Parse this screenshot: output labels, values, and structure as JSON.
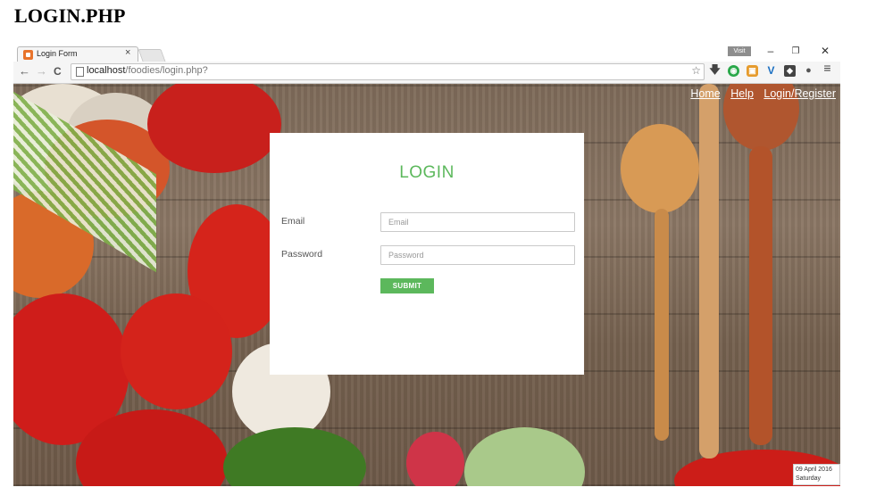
{
  "doc_title": "LOGIN.PHP",
  "browser": {
    "tab_title": "Login Form",
    "tab_close": "×",
    "user_badge": "Visit",
    "window_controls": {
      "minimize": "–",
      "restore": "❐",
      "close": "✕"
    },
    "nav": {
      "back": "←",
      "forward": "→",
      "reload": "C"
    },
    "url_host": "localhost",
    "url_path": "/foodies/login.php?",
    "star": "☆",
    "menu": "≡",
    "extension_icons": [
      "download-icon",
      "extension-green-icon",
      "extension-orange-icon",
      "extension-v-icon",
      "extension-dark-icon",
      "extension-bulb-icon"
    ]
  },
  "site_nav": {
    "home": "Home",
    "help": "Help",
    "login_register": "Login/Register"
  },
  "login": {
    "title": "LOGIN",
    "email_label": "Email",
    "email_placeholder": "Email",
    "email_value": "",
    "password_label": "Password",
    "password_placeholder": "Password",
    "password_value": "",
    "submit_label": "SUBMIT"
  },
  "taskbar": {
    "date": "09 April 2016",
    "day": "Saturday"
  },
  "colors": {
    "accent_green": "#5cb85c",
    "nav_link": "#ffffff"
  }
}
